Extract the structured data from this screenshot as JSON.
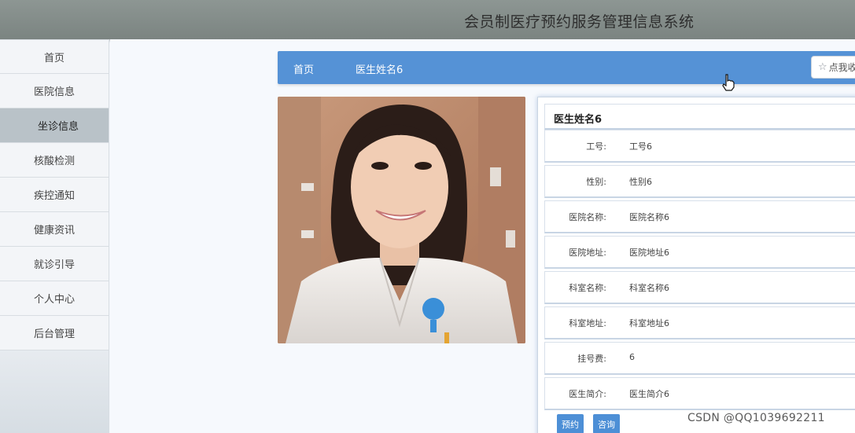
{
  "app": {
    "title": "会员制医疗预约服务管理信息系统"
  },
  "sidebar": {
    "items": [
      {
        "label": "首页",
        "active": false
      },
      {
        "label": "医院信息",
        "active": false
      },
      {
        "label": "坐诊信息",
        "active": true
      },
      {
        "label": "核酸检测",
        "active": false
      },
      {
        "label": "疾控通知",
        "active": false
      },
      {
        "label": "健康资讯",
        "active": false
      },
      {
        "label": "就诊引导",
        "active": false
      },
      {
        "label": "个人中心",
        "active": false
      },
      {
        "label": "后台管理",
        "active": false
      }
    ]
  },
  "breadcrumb": {
    "home": "首页",
    "current": "医生姓名6"
  },
  "collect_button": {
    "label": "点我收藏",
    "icon": "star-outline-icon"
  },
  "photo": {
    "icon": "doctor-photo"
  },
  "detail": {
    "name": "医生姓名6",
    "fields": [
      {
        "label": "工号:",
        "value": "工号6"
      },
      {
        "label": "性别:",
        "value": "性别6"
      },
      {
        "label": "医院名称:",
        "value": "医院名称6"
      },
      {
        "label": "医院地址:",
        "value": "医院地址6"
      },
      {
        "label": "科室名称:",
        "value": "科室名称6"
      },
      {
        "label": "科室地址:",
        "value": "科室地址6"
      },
      {
        "label": "挂号费:",
        "value": "6"
      },
      {
        "label": "医生简介:",
        "value": "医生简介6"
      }
    ],
    "actions": {
      "book": "预约",
      "consult": "咨询"
    }
  },
  "watermark": "CSDN @QQ1039692211",
  "colors": {
    "accent": "#5592d6",
    "topbar": "#858e8b",
    "active_nav": "#b9c2c8"
  }
}
